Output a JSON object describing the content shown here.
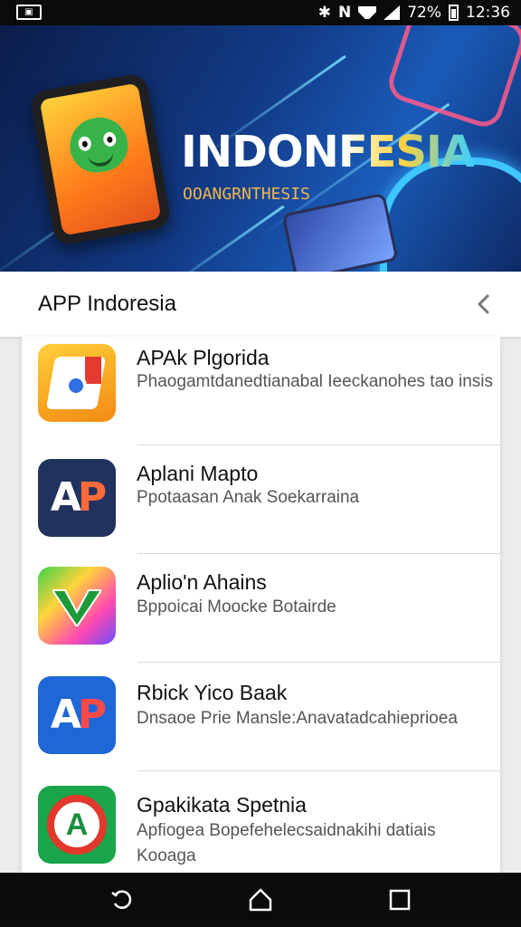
{
  "status_bar": {
    "battery_text": "72%",
    "time": "12:36",
    "carrier_icon": "n-icon"
  },
  "hero": {
    "title": "INDONFESIA",
    "subtitle": "OOANGRNTHESIS"
  },
  "header": {
    "title": "APP Indoresia"
  },
  "apps": [
    {
      "name": "APAk Plgorida",
      "description": "Phaogamtdanedtianabal Ieeckanohes tao insis",
      "icon": "browser-icon"
    },
    {
      "name": "Aplani Mapto",
      "description": "Ppotaasan Anak Soekarraina",
      "icon": "ap-logo-icon"
    },
    {
      "name": "Aplio'n Ahains",
      "description": "Bppoicai Moocke Botairde",
      "icon": "checkmark-icon"
    },
    {
      "name": "Rbick Yico Baak",
      "description": "Dnsaoe Prie Mansle:Anavatadcahieprioea",
      "icon": "ap-logo-icon"
    },
    {
      "name": "Gpakikata Spetnia",
      "description": "Apfiogea Bopefehelecsaidnakihi datiais Kooaga",
      "icon": "a-logo-icon"
    }
  ]
}
